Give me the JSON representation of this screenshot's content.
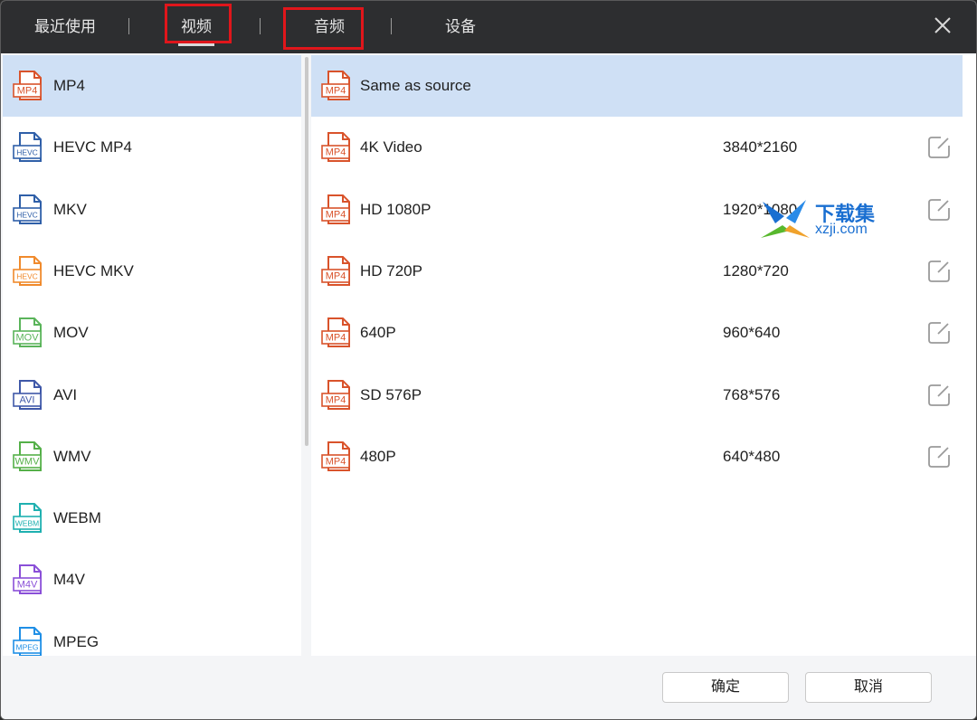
{
  "tabs": [
    {
      "label": "最近使用"
    },
    {
      "label": "视频"
    },
    {
      "label": "音频"
    },
    {
      "label": "设备"
    }
  ],
  "formats": [
    {
      "label": "MP4",
      "icon": "MP4",
      "color": "#d9532b"
    },
    {
      "label": "HEVC MP4",
      "icon": "HEVC",
      "color": "#2f5fa8"
    },
    {
      "label": "MKV",
      "icon": "HEVC",
      "color": "#2f5fa8"
    },
    {
      "label": "HEVC MKV",
      "icon": "HEVC",
      "color": "#f08a2c"
    },
    {
      "label": "MOV",
      "icon": "MOV",
      "color": "#5ab45a"
    },
    {
      "label": "AVI",
      "icon": "AVI",
      "color": "#3f58a8"
    },
    {
      "label": "WMV",
      "icon": "WMV",
      "color": "#55b049"
    },
    {
      "label": "WEBM",
      "icon": "WEBM",
      "color": "#1fb0b0"
    },
    {
      "label": "M4V",
      "icon": "M4V",
      "color": "#8a4fd8"
    },
    {
      "label": "MPEG",
      "icon": "MPEG",
      "color": "#1f8fe6"
    }
  ],
  "presets": [
    {
      "label": "Same as source",
      "resolution": "",
      "icon": "MP4"
    },
    {
      "label": "4K Video",
      "resolution": "3840*2160",
      "icon": "MP4"
    },
    {
      "label": "HD 1080P",
      "resolution": "1920*1080",
      "icon": "MP4"
    },
    {
      "label": "HD 720P",
      "resolution": "1280*720",
      "icon": "MP4"
    },
    {
      "label": "640P",
      "resolution": "960*640",
      "icon": "MP4"
    },
    {
      "label": "SD 576P",
      "resolution": "768*576",
      "icon": "MP4"
    },
    {
      "label": "480P",
      "resolution": "640*480",
      "icon": "MP4"
    }
  ],
  "footer": {
    "ok_label": "确定",
    "cancel_label": "取消"
  },
  "watermark": {
    "line1": "下载集",
    "line2": "xzji.com"
  },
  "colors": {
    "selected": "#cfe0f5",
    "highlight_box": "#e0161b",
    "topbar": "#2d2e30",
    "mp4_icon": "#d9532b"
  }
}
